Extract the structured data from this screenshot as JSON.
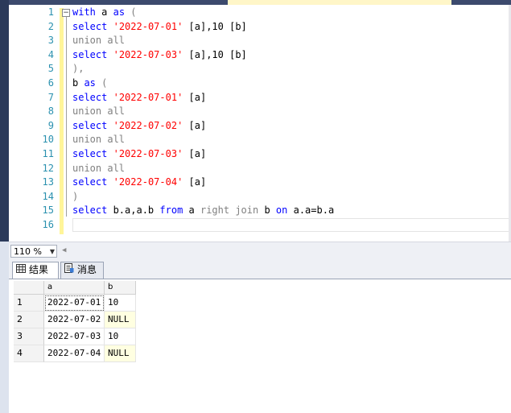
{
  "editor": {
    "line_numbers": [
      "1",
      "2",
      "3",
      "4",
      "5",
      "6",
      "7",
      "8",
      "9",
      "10",
      "11",
      "12",
      "13",
      "14",
      "15",
      "16"
    ],
    "lines": [
      [
        {
          "t": "with",
          "c": "kw"
        },
        {
          "t": " a ",
          "c": ""
        },
        {
          "t": "as",
          "c": "kw"
        },
        {
          "t": " (",
          "c": "gr"
        }
      ],
      [
        {
          "t": "select",
          "c": "kw"
        },
        {
          "t": " ",
          "c": ""
        },
        {
          "t": "'2022-07-01'",
          "c": "st"
        },
        {
          "t": " [a],10 [b]",
          "c": ""
        }
      ],
      [
        {
          "t": "union all",
          "c": "gr"
        }
      ],
      [
        {
          "t": "select",
          "c": "kw"
        },
        {
          "t": " ",
          "c": ""
        },
        {
          "t": "'2022-07-03'",
          "c": "st"
        },
        {
          "t": " [a],10 [b]",
          "c": ""
        }
      ],
      [
        {
          "t": "),",
          "c": "gr"
        }
      ],
      [
        {
          "t": "b ",
          "c": ""
        },
        {
          "t": "as",
          "c": "kw"
        },
        {
          "t": " (",
          "c": "gr"
        }
      ],
      [
        {
          "t": "select",
          "c": "kw"
        },
        {
          "t": " ",
          "c": ""
        },
        {
          "t": "'2022-07-01'",
          "c": "st"
        },
        {
          "t": " [a]",
          "c": ""
        }
      ],
      [
        {
          "t": "union all",
          "c": "gr"
        }
      ],
      [
        {
          "t": "select",
          "c": "kw"
        },
        {
          "t": " ",
          "c": ""
        },
        {
          "t": "'2022-07-02'",
          "c": "st"
        },
        {
          "t": " [a]",
          "c": ""
        }
      ],
      [
        {
          "t": "union all",
          "c": "gr"
        }
      ],
      [
        {
          "t": "select",
          "c": "kw"
        },
        {
          "t": " ",
          "c": ""
        },
        {
          "t": "'2022-07-03'",
          "c": "st"
        },
        {
          "t": " [a]",
          "c": ""
        }
      ],
      [
        {
          "t": "union all",
          "c": "gr"
        }
      ],
      [
        {
          "t": "select",
          "c": "kw"
        },
        {
          "t": " ",
          "c": ""
        },
        {
          "t": "'2022-07-04'",
          "c": "st"
        },
        {
          "t": " [a]",
          "c": ""
        }
      ],
      [
        {
          "t": ")",
          "c": "gr"
        }
      ],
      [
        {
          "t": "select",
          "c": "kw"
        },
        {
          "t": " b.a,a.b ",
          "c": ""
        },
        {
          "t": "from",
          "c": "kw"
        },
        {
          "t": " a ",
          "c": ""
        },
        {
          "t": "right join",
          "c": "gr"
        },
        {
          "t": " b ",
          "c": ""
        },
        {
          "t": "on",
          "c": "kw"
        },
        {
          "t": " a.a=b.a",
          "c": ""
        }
      ],
      []
    ]
  },
  "status": {
    "zoom": "110 %"
  },
  "result_tabs": {
    "results": "结果",
    "messages": "消息"
  },
  "grid": {
    "columns": [
      "a",
      "b"
    ],
    "rows": [
      {
        "num": "1",
        "a": "2022-07-01",
        "b": "10"
      },
      {
        "num": "2",
        "a": "2022-07-02",
        "b": "NULL"
      },
      {
        "num": "3",
        "a": "2022-07-03",
        "b": "10"
      },
      {
        "num": "4",
        "a": "2022-07-04",
        "b": "NULL"
      }
    ]
  },
  "colors": {
    "keyword": "#0000ff",
    "gray_keyword": "#808080",
    "string": "#ff0000",
    "line_number": "#2b91af",
    "null_cell": "#ffffe1"
  }
}
